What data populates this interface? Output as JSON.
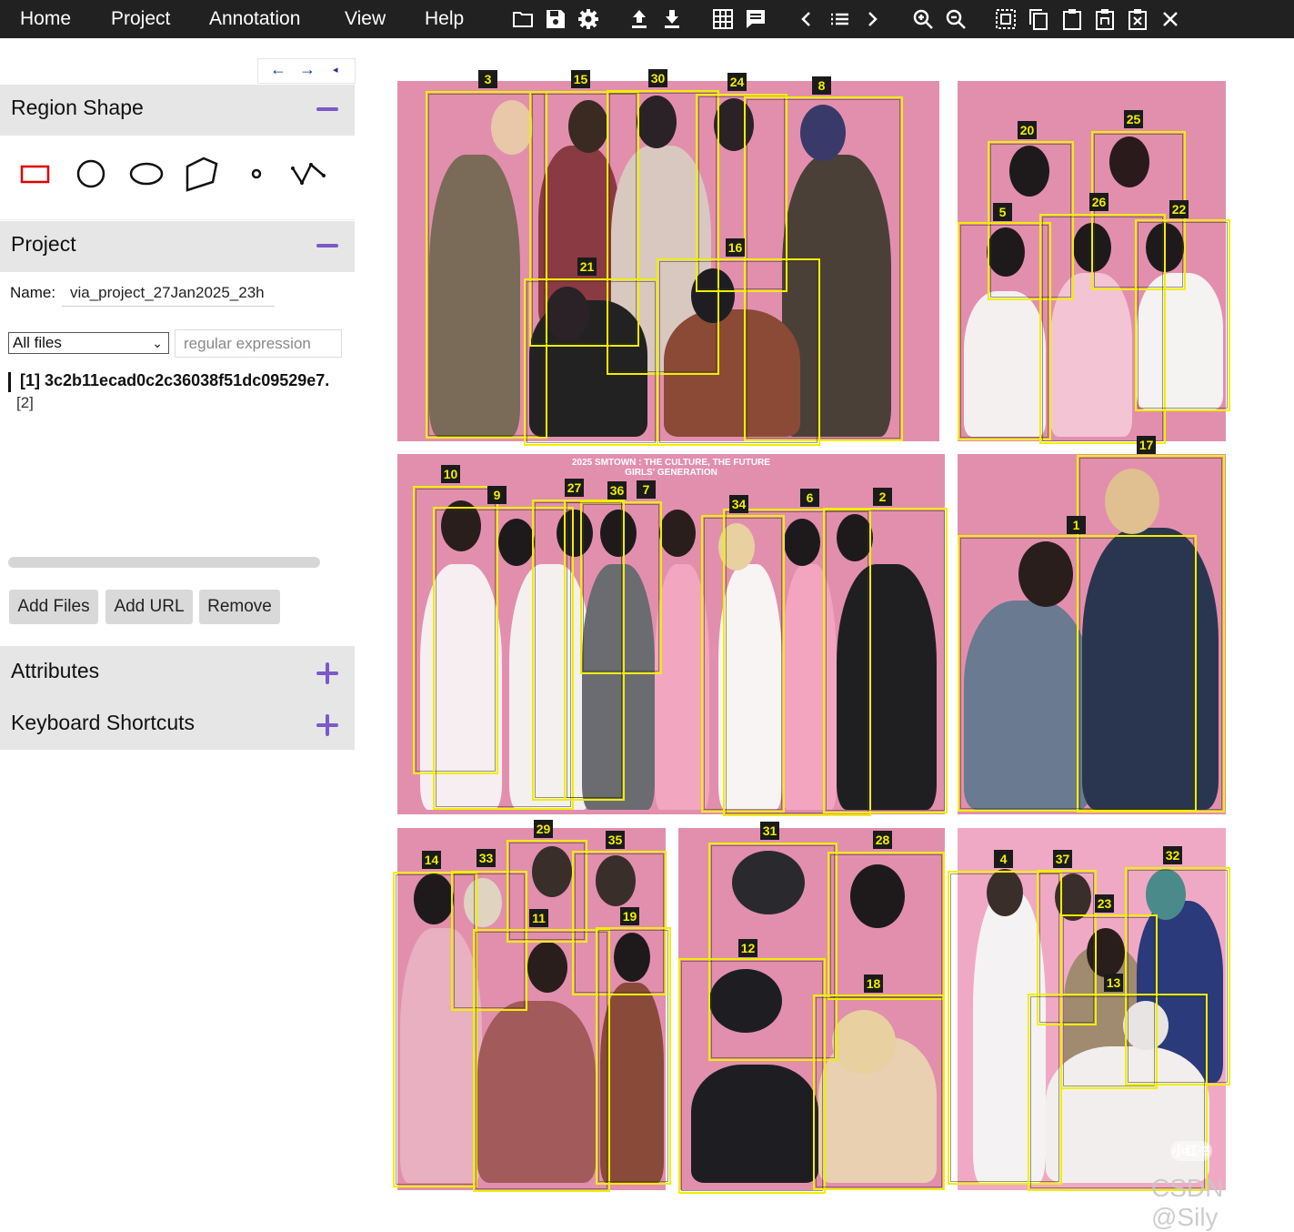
{
  "menu": {
    "home": "Home",
    "project": "Project",
    "annotation": "Annotation",
    "view": "View",
    "help": "Help"
  },
  "toolbar_icons": [
    "open-folder-icon",
    "save-icon",
    "settings-icon",
    "upload-icon",
    "download-icon",
    "grid-view-icon",
    "comment-icon",
    "prev-image-icon",
    "list-icon",
    "next-image-icon",
    "zoom-in-icon",
    "zoom-out-icon",
    "select-all-icon",
    "copy-icon",
    "paste-icon",
    "paste-special-icon",
    "delete-region-icon",
    "close-icon"
  ],
  "sidebar": {
    "nav_arrows": [
      "←",
      "→",
      "◂"
    ],
    "region_shape": {
      "title": "Region Shape",
      "shapes": [
        "rectangle",
        "circle",
        "ellipse",
        "polygon",
        "point",
        "polyline"
      ],
      "selected": "rectangle"
    },
    "project": {
      "title": "Project",
      "name_label": "Name:",
      "name_value": "via_project_27Jan2025_23h",
      "filter_select": "All files",
      "filter_placeholder": "regular expression",
      "files": [
        "[1] 3c2b11ecad0c2c36038f51dc09529e7.",
        "[2]"
      ],
      "buttons": [
        "Add Files",
        "Add URL",
        "Remove"
      ]
    },
    "attributes_title": "Attributes",
    "shortcuts_title": "Keyboard Shortcuts"
  },
  "canvas": {
    "headline_line1": "2025 SMTOWN : THE CULTURE, THE FUTURE",
    "headline_line2": "GIRLS' GENERATION",
    "watermark_badge": "小红书",
    "watermark_credit": "CSDN @Sily",
    "region_ids": [
      "1",
      "2",
      "3",
      "4",
      "5",
      "6",
      "7",
      "8",
      "9",
      "10",
      "11",
      "12",
      "13",
      "14",
      "15",
      "16",
      "17",
      "18",
      "19",
      "20",
      "21",
      "22",
      "23",
      "24",
      "25",
      "26",
      "27",
      "28",
      "29",
      "30",
      "31",
      "32",
      "33",
      "34",
      "35",
      "36",
      "37"
    ]
  },
  "colors": {
    "topbar": "#212121",
    "accent": "#7b59c9",
    "region_stroke": "#f0ee00",
    "photo_bg": "#e28fae"
  }
}
